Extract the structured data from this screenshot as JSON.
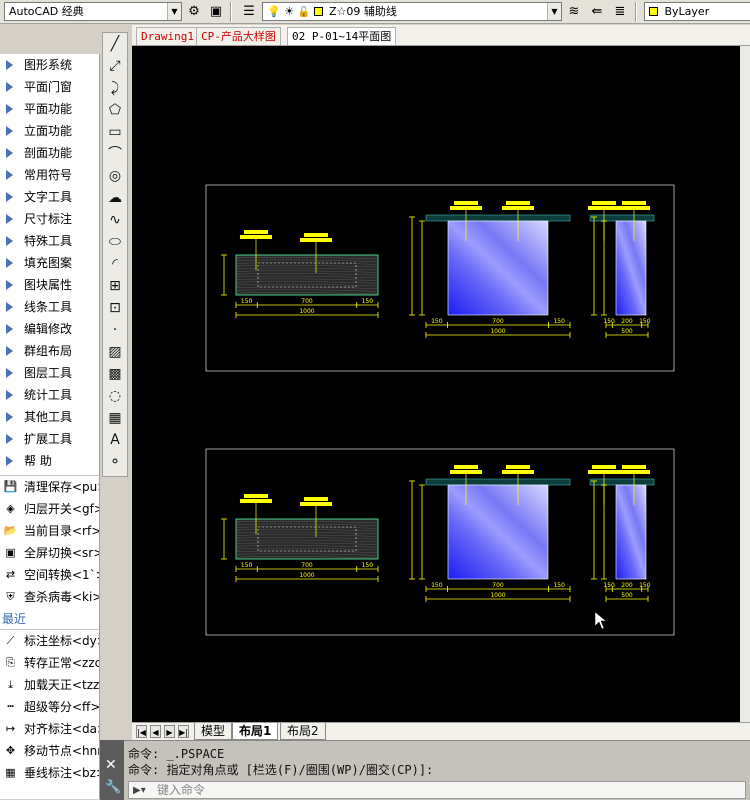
{
  "toolbar": {
    "workspace": "AutoCAD 经典",
    "layer": "Z☆09 辅助线",
    "layer_color": "#ffff00",
    "color_control": "ByLayer"
  },
  "doc_tabs": [
    "Drawing1",
    "CP-产品大样图",
    "02 P-01~14平面图"
  ],
  "left_menu": {
    "categories": [
      "图形系统",
      "平面门窗",
      "平面功能",
      "立面功能",
      "剖面功能",
      "常用符号",
      "文字工具",
      "尺寸标注",
      "特殊工具",
      "填充图案",
      "图块属性",
      "线条工具",
      "编辑修改",
      "群组布局",
      "图层工具",
      "统计工具",
      "其他工具",
      "扩展工具",
      "帮    助"
    ],
    "tools": [
      {
        "label": "清理保存<pu>",
        "icon": "save-icon"
      },
      {
        "label": "归层开关<gf>",
        "icon": "layer-switch-icon"
      },
      {
        "label": "当前目录<rf>",
        "icon": "folder-icon"
      },
      {
        "label": "全屏切换<sr>",
        "icon": "fullscreen-icon"
      },
      {
        "label": "空间转换<1`>",
        "icon": "space-convert-icon"
      },
      {
        "label": "查杀病毒<ki>",
        "icon": "shield-icon"
      }
    ],
    "recent_label": "最近",
    "recent": [
      {
        "label": "标注坐标<dy>",
        "icon": "coord-icon"
      },
      {
        "label": "转存正常<zzc",
        "icon": "convert-icon"
      },
      {
        "label": "加载天正<tzz",
        "icon": "load-icon"
      },
      {
        "label": "超级等分<ff>",
        "icon": "divide-icon"
      },
      {
        "label": "对齐标注<da>",
        "icon": "align-dim-icon"
      },
      {
        "label": "移动节点<hnn",
        "icon": "move-node-icon"
      },
      {
        "label": "垂线标注<bz>",
        "icon": "perp-dim-icon"
      }
    ]
  },
  "draw_tools": [
    {
      "name": "line-tool",
      "glyph": "╱"
    },
    {
      "name": "construction-line-tool",
      "glyph": "⤢"
    },
    {
      "name": "polyline-tool",
      "glyph": "⤸"
    },
    {
      "name": "polygon-tool",
      "glyph": "⬠"
    },
    {
      "name": "rectangle-tool",
      "glyph": "▭"
    },
    {
      "name": "arc-tool",
      "glyph": "⌒"
    },
    {
      "name": "circle-tool",
      "glyph": "◎"
    },
    {
      "name": "revcloud-tool",
      "glyph": "☁"
    },
    {
      "name": "spline-tool",
      "glyph": "∿"
    },
    {
      "name": "ellipse-tool",
      "glyph": "⬭"
    },
    {
      "name": "ellipse-arc-tool",
      "glyph": "◜"
    },
    {
      "name": "insert-block-tool",
      "glyph": "⊞"
    },
    {
      "name": "make-block-tool",
      "glyph": "⊡"
    },
    {
      "name": "point-tool",
      "glyph": "·"
    },
    {
      "name": "hatch-tool",
      "glyph": "▨"
    },
    {
      "name": "gradient-tool",
      "glyph": "▩"
    },
    {
      "name": "region-tool",
      "glyph": "◌"
    },
    {
      "name": "table-tool",
      "glyph": "▦"
    },
    {
      "name": "mtext-tool",
      "glyph": "A"
    },
    {
      "name": "add-selected-tool",
      "glyph": "⚬"
    }
  ],
  "layout_tabs": [
    "模型",
    "布局1",
    "布局2"
  ],
  "active_layout": "布局1",
  "command": {
    "line1": "命令:  _.PSPACE",
    "line2": "命令: 指定对角点或 [栏选(F)/圈围(WP)/圈交(CP)]:",
    "placeholder": "键入命令"
  },
  "drawing_panels": [
    {
      "dims_a": {
        "top": [
          "700",
          "150"
        ],
        "bottom": [
          "150",
          "700",
          "150"
        ],
        "total": "1000"
      },
      "dims_b": {
        "bottom": [
          "150",
          "700",
          "150"
        ],
        "total": "1000"
      },
      "dims_c": {
        "bottom": [
          "150",
          "200",
          "150"
        ],
        "total": "500"
      }
    },
    {
      "dims_a": {
        "bottom": [
          "150",
          "700",
          "150"
        ],
        "total": "1000"
      },
      "dims_b": {
        "bottom": [
          "150",
          "700",
          "150"
        ],
        "total": "1000"
      },
      "dims_c": {
        "bottom": [
          "150",
          "200",
          "150"
        ],
        "total": "500"
      }
    }
  ],
  "colors": {
    "canvas": "#000000",
    "dim": "#ffff00",
    "tag": "#ffff00",
    "glass_dark": "#1e1ef0",
    "glass_light": "#d8d8ff",
    "wood": "#2a2a2a",
    "frame": "#c8c8c8"
  }
}
